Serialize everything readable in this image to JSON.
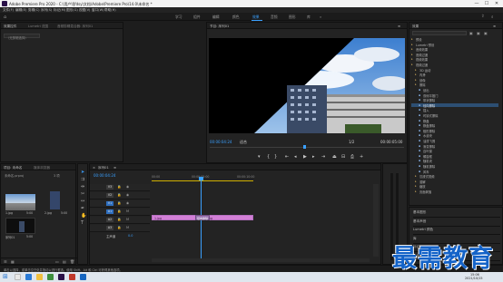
{
  "window": {
    "title": "Adobe Premiere Pro 2020 - C:\\用户\\fjfdsy\\文档\\Adobe\\Premiere Pro\\14.0\\未命名 *",
    "minimize": "—",
    "maximize": "☐",
    "close": "✕"
  },
  "menu": [
    "文件(F)",
    "编辑(E)",
    "剪辑(C)",
    "序列(S)",
    "标记(M)",
    "图形(G)",
    "视图(V)",
    "窗口(W)",
    "帮助(H)"
  ],
  "workspaces": [
    "学习",
    "组件",
    "编辑",
    "颜色",
    "效果",
    "音频",
    "图形",
    "库"
  ],
  "active_workspace": "效果",
  "source_panel": {
    "tabs": [
      "效果控件",
      "Lumetri 范围",
      "音频剪辑混合器: 序列01"
    ],
    "search_placeholder": "（无剪辑选择）"
  },
  "program_monitor": {
    "title": "节目: 序列01",
    "timecode": "00:00:04:24",
    "fit": "适合",
    "quality": "1/2",
    "duration": "00:00:05:00"
  },
  "effects_panel": {
    "title": "效果",
    "items": [
      {
        "label": "预设",
        "depth": 1
      },
      {
        "label": "Lumetri 预设",
        "depth": 1
      },
      {
        "label": "音频效果",
        "depth": 1
      },
      {
        "label": "音频过渡",
        "depth": 1
      },
      {
        "label": "视频效果",
        "depth": 1
      },
      {
        "label": "视频过渡",
        "depth": 1
      },
      {
        "label": "3D 运动",
        "depth": 2
      },
      {
        "label": "内滑",
        "depth": 2
      },
      {
        "label": "划像",
        "depth": 2
      },
      {
        "label": "擦除",
        "depth": 2
      },
      {
        "label": "划出",
        "depth": 3
      },
      {
        "label": "双侧平推门",
        "depth": 3
      },
      {
        "label": "带状擦除",
        "depth": 3
      },
      {
        "label": "径向擦除",
        "depth": 3,
        "selected": true
      },
      {
        "label": "插入",
        "depth": 3
      },
      {
        "label": "时钟式擦除",
        "depth": 3
      },
      {
        "label": "棋盘",
        "depth": 3
      },
      {
        "label": "棋盘擦除",
        "depth": 3
      },
      {
        "label": "楔形擦除",
        "depth": 3
      },
      {
        "label": "水波块",
        "depth": 3
      },
      {
        "label": "油漆飞溅",
        "depth": 3
      },
      {
        "label": "渐变擦除",
        "depth": 3
      },
      {
        "label": "百叶窗",
        "depth": 3
      },
      {
        "label": "螺旋框",
        "depth": 3
      },
      {
        "label": "随机块",
        "depth": 3
      },
      {
        "label": "随机擦除",
        "depth": 3
      },
      {
        "label": "风车",
        "depth": 3
      },
      {
        "label": "沉浸式视频",
        "depth": 2
      },
      {
        "label": "溶解",
        "depth": 2
      },
      {
        "label": "缩放",
        "depth": 2
      },
      {
        "label": "页面剥落",
        "depth": 2
      }
    ],
    "lower_items": [
      "基本图形",
      "基本声音",
      "Lumetri 颜色",
      "库",
      "标记",
      "历史记录"
    ]
  },
  "project_panel": {
    "tabs": [
      "项目: 未命名",
      "媒体浏览器"
    ],
    "path": "未命名.prproj",
    "item_count": "3 项",
    "clips": [
      {
        "name": "1.jpg",
        "duration": "5:00"
      },
      {
        "name": "2.jpg",
        "duration": "5:00"
      },
      {
        "name": "序列01",
        "duration": "5:00"
      }
    ]
  },
  "timeline": {
    "title": "序列01",
    "timecode": "00:00:04:24",
    "ruler": [
      "00:00",
      "00:00:05:00",
      "00:00:10:00"
    ],
    "tracks": [
      "V3",
      "V2",
      "V1",
      "A1",
      "A2",
      "A3"
    ],
    "master": "主声道",
    "master_value": "0.0",
    "clip_a": "1.jpg",
    "clip_b": "2.jpg",
    "transition": "径向擦除"
  },
  "status": "单击以选择，或单击空白处并拖动以进行框选。使用 Shift、Alt 和 Ctrl 可获得其他选项。",
  "watermark": "最需教育",
  "taskbar": {
    "time": "15:06",
    "date": "2021/10/15"
  }
}
